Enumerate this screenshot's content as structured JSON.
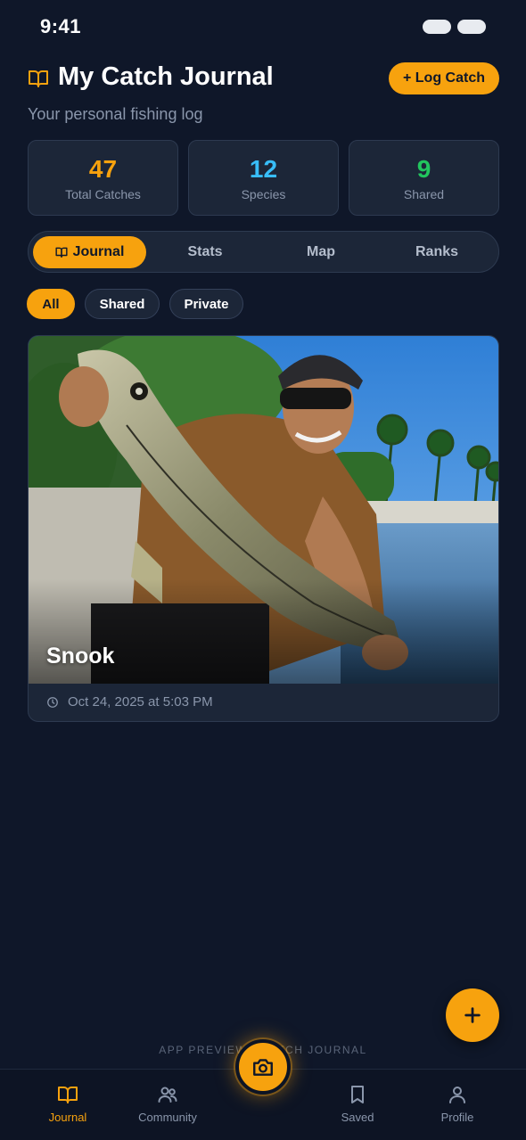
{
  "status_bar": {
    "time": "9:41"
  },
  "header": {
    "title": "My Catch Journal",
    "subtitle": "Your personal fishing log",
    "log_button": "+ Log Catch",
    "icon": "book-open-icon"
  },
  "stats": [
    {
      "value": "47",
      "label": "Total Catches",
      "color": "#f7a20e"
    },
    {
      "value": "12",
      "label": "Species",
      "color": "#38bdf8"
    },
    {
      "value": "9",
      "label": "Shared",
      "color": "#22c55e"
    }
  ],
  "tabs": [
    {
      "label": "Journal",
      "active": true,
      "icon": "book-open-icon"
    },
    {
      "label": "Stats",
      "active": false
    },
    {
      "label": "Map",
      "active": false
    },
    {
      "label": "Ranks",
      "active": false
    }
  ],
  "filters": [
    {
      "label": "All",
      "active": true
    },
    {
      "label": "Shared",
      "active": false
    },
    {
      "label": "Private",
      "active": false
    }
  ],
  "catches": [
    {
      "species": "Snook",
      "datetime": "Oct 24, 2025 at 5:03 PM",
      "icon": "clock-icon"
    }
  ],
  "preview_label": "APP PREVIEW · CATCH JOURNAL",
  "bottom_nav": {
    "items": [
      {
        "label": "Journal",
        "active": true,
        "icon": "book-open-icon"
      },
      {
        "label": "Community",
        "active": false,
        "icon": "users-icon"
      },
      {
        "label": "Saved",
        "active": false,
        "icon": "bookmark-icon"
      },
      {
        "label": "Profile",
        "active": false,
        "icon": "user-icon"
      }
    ],
    "center_icon": "camera-icon"
  },
  "colors": {
    "background": "#0f1729",
    "card": "#1c2638",
    "accent": "#f7a20e",
    "muted_text": "#8a96ab"
  }
}
